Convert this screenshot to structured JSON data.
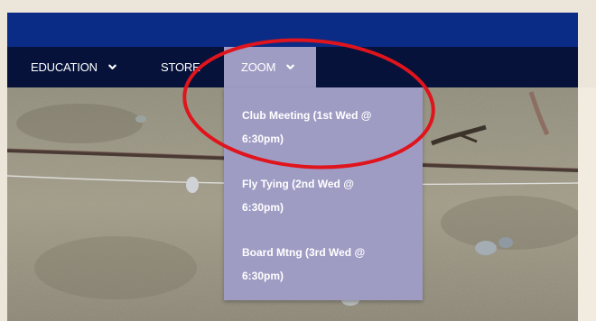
{
  "nav": {
    "items": [
      {
        "label": "EDUCATION",
        "icon": "chevron-down-icon"
      },
      {
        "label": "STORE"
      },
      {
        "label": "ZOOM",
        "icon": "chevron-down-icon",
        "active": true
      }
    ]
  },
  "zoom_menu": {
    "items": [
      {
        "line1": "Club Meeting (1st Wed @",
        "line2": "6:30pm)"
      },
      {
        "line1": "Fly Tying (2nd Wed @",
        "line2": "6:30pm)"
      },
      {
        "line1": "Board Mtng (3rd Wed @",
        "line2": "6:30pm)"
      }
    ]
  },
  "annotation": {
    "shape": "ellipse",
    "color": "#e0141c",
    "encircles": "zoom_menu.items.0"
  },
  "colors": {
    "banner": "#0b2c86",
    "navbar": "#06123a",
    "menu_highlight": "#9f9cc4",
    "background": "#ece6da"
  }
}
